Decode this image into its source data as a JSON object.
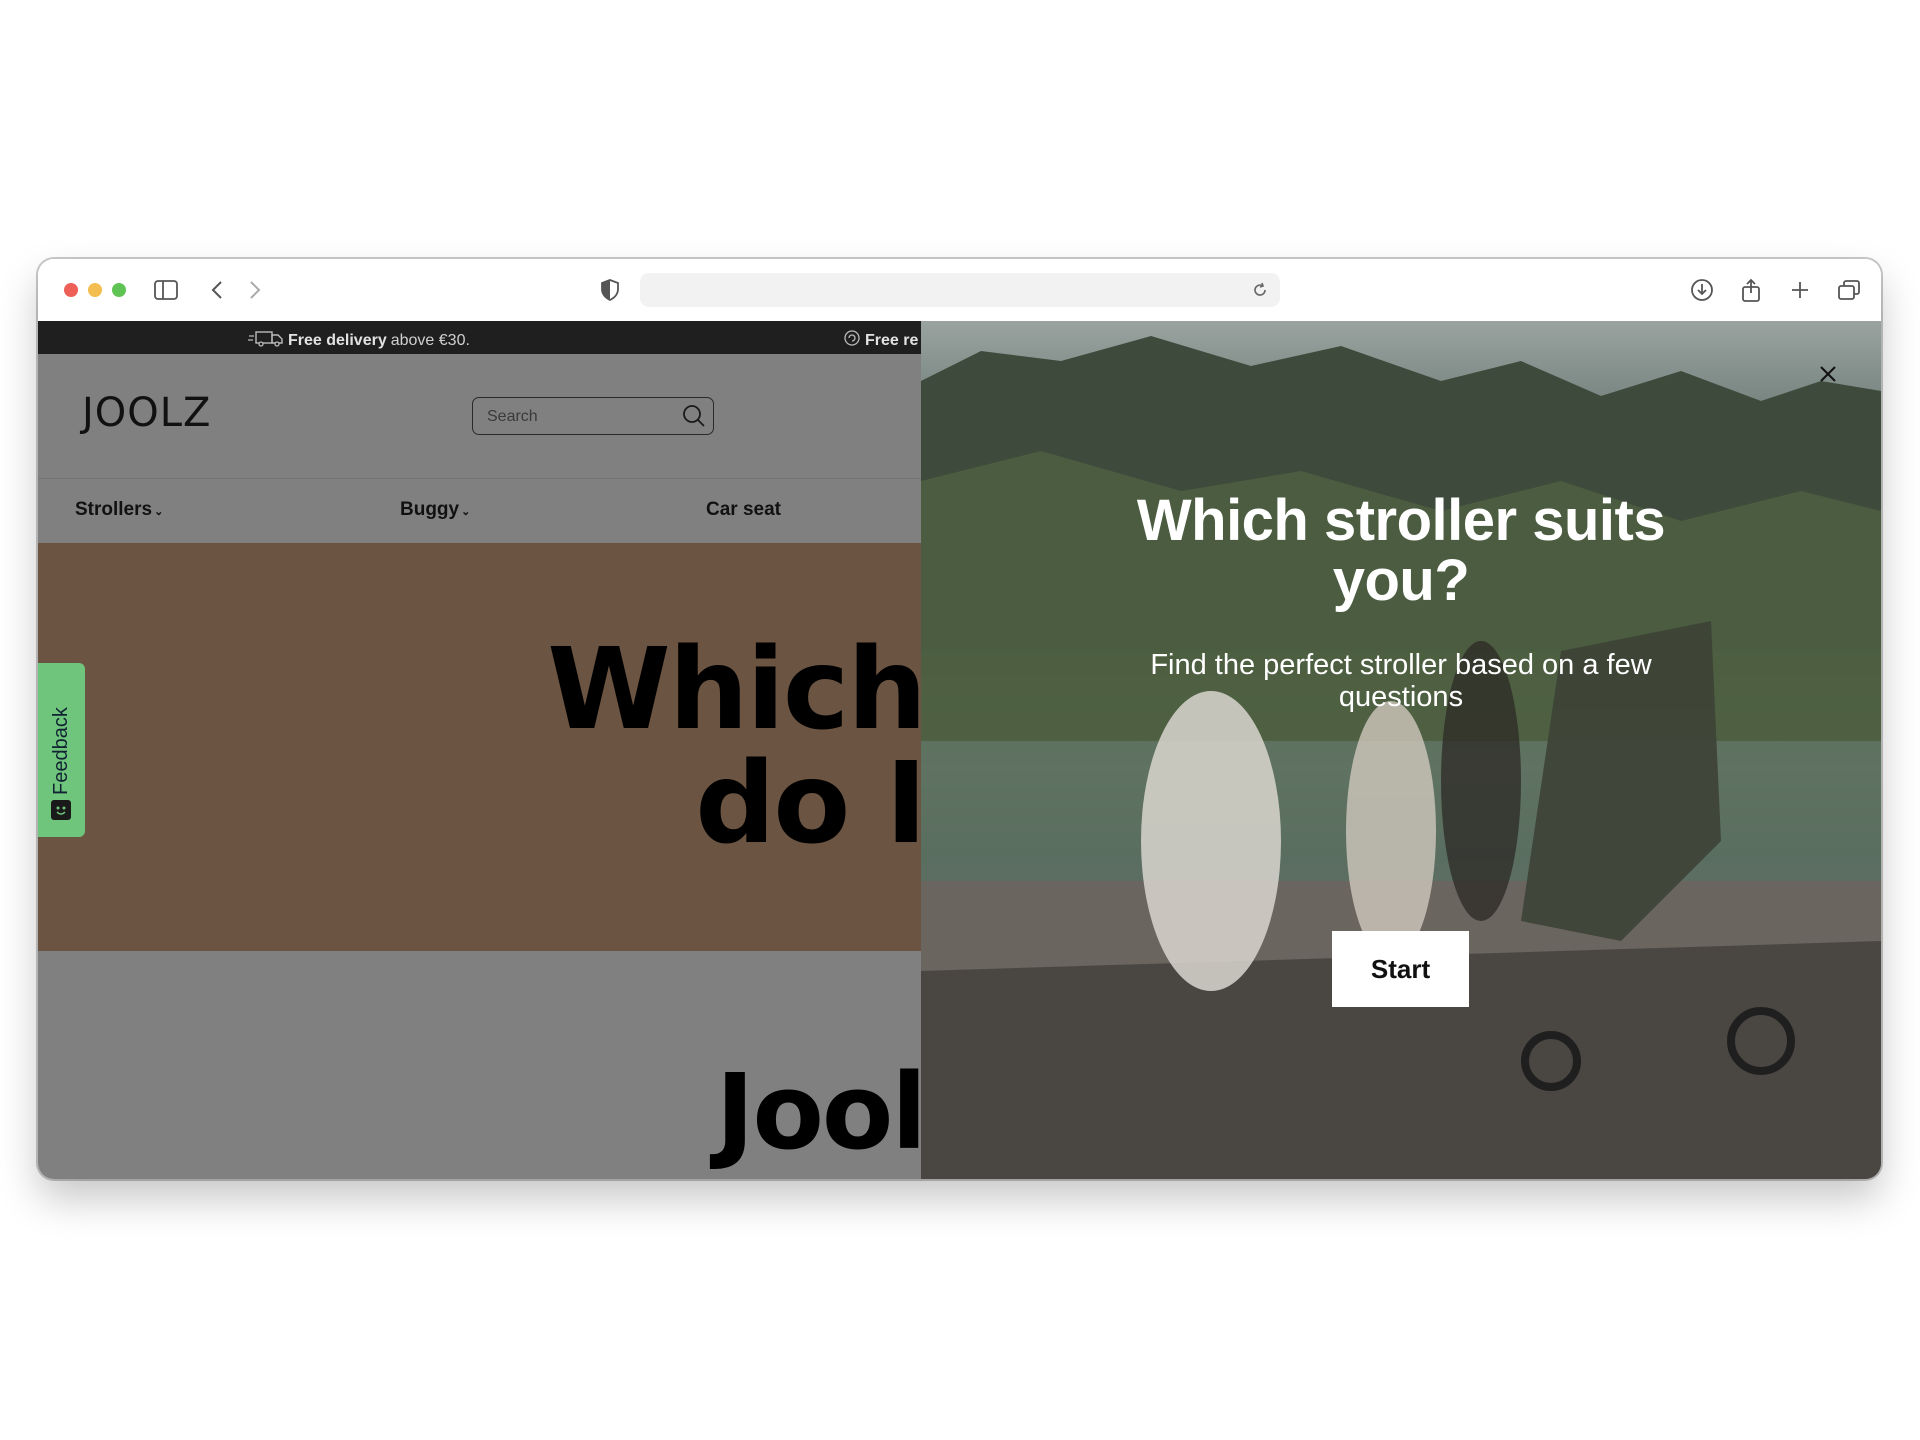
{
  "browser": {
    "address_value": "",
    "icons": [
      "sidebar-icon",
      "back-icon",
      "forward-icon",
      "shield-icon",
      "reload-icon",
      "download-icon",
      "share-icon",
      "new-tab-icon",
      "tabs-icon"
    ]
  },
  "announcement": {
    "items": [
      {
        "bold": "Free delivery",
        "text": " above €30."
      },
      {
        "bold": "Free re",
        "text": ""
      }
    ]
  },
  "header": {
    "logo": "JOOLZ",
    "search_placeholder": "Search"
  },
  "nav": {
    "items": [
      {
        "label": "Strollers",
        "chevron": "⌄"
      },
      {
        "label": "Buggy",
        "chevron": "⌄"
      },
      {
        "label": "Car seat",
        "chevron": ""
      }
    ]
  },
  "hero": {
    "line1": "Which",
    "line2": "do I",
    "bottom": "Jool"
  },
  "feedback": {
    "label": "Feedback"
  },
  "quiz": {
    "title": "Which stroller suits you?",
    "subtitle": "Find the perfect stroller based on a few questions",
    "start_label": "Start"
  },
  "colors": {
    "overlay_gray": "#808080",
    "announce_bar": "#1f1f1f",
    "hero_brown": "#6b5441",
    "feedback_green": "#6fc57b"
  }
}
